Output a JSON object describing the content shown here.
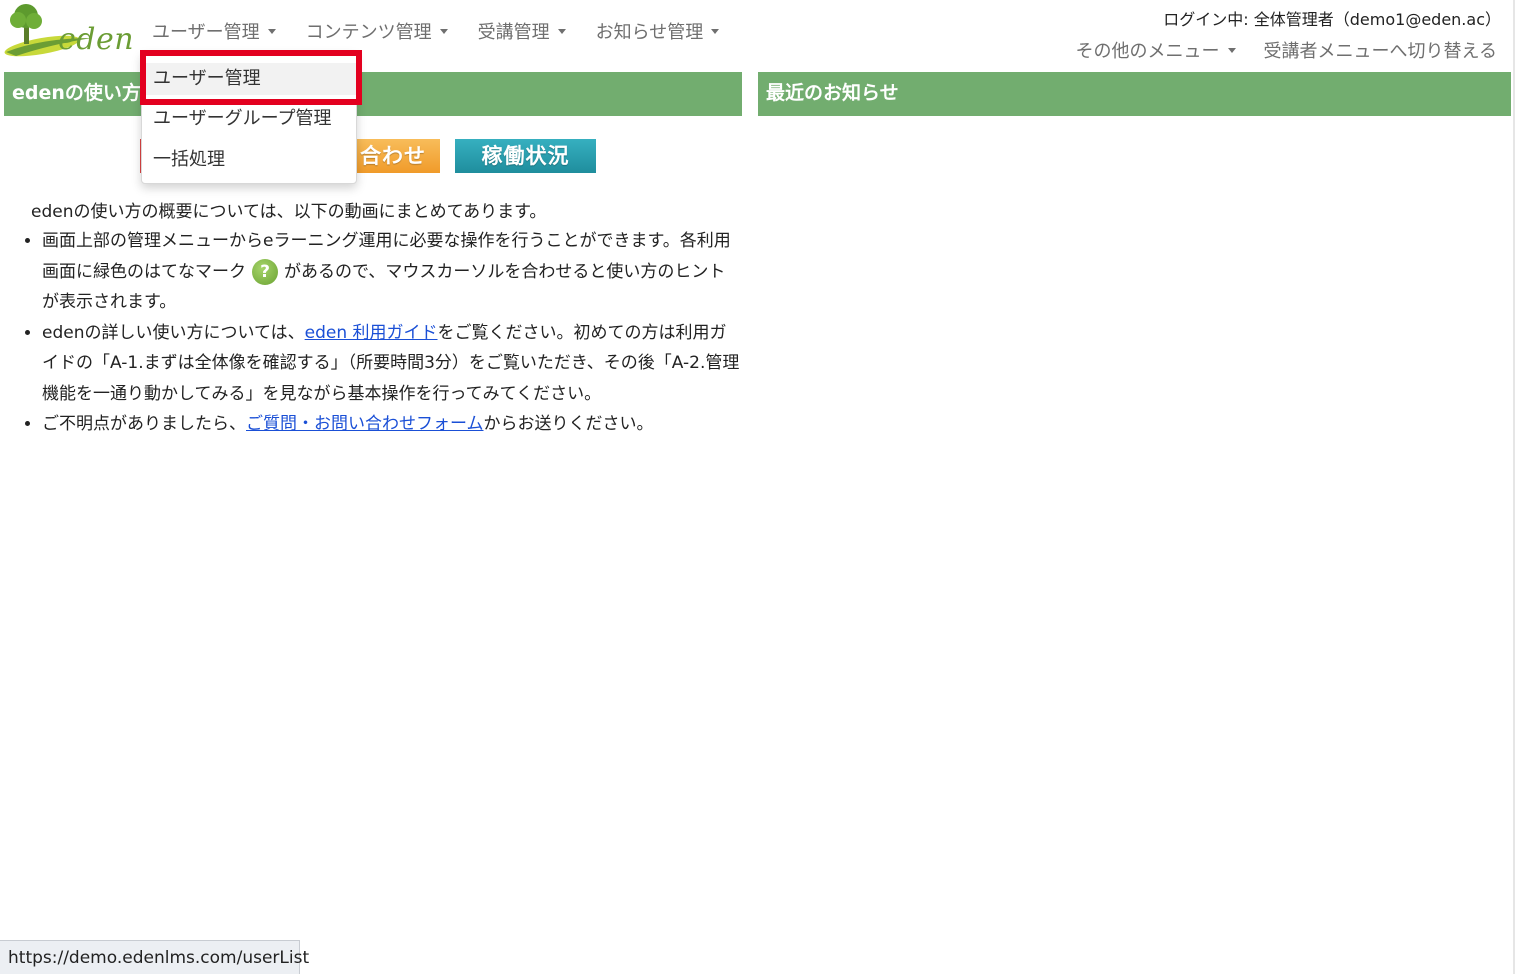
{
  "header": {
    "logo_text": "eden",
    "nav": [
      {
        "label": "ユーザー管理"
      },
      {
        "label": "コンテンツ管理"
      },
      {
        "label": "受講管理"
      },
      {
        "label": "お知らせ管理"
      }
    ],
    "login_info": "ログイン中: 全体管理者（demo1@eden.ac）",
    "other_menu": "その他のメニュー",
    "switch_menu": "受講者メニューへ切り替える"
  },
  "dropdown": {
    "items": [
      {
        "label": "ユーザー管理"
      },
      {
        "label": "ユーザーグループ管理"
      },
      {
        "label": "一括処理"
      }
    ]
  },
  "left_panel": {
    "title": "edenの使い方",
    "buttons": {
      "contact": "合わせ",
      "status": "稼働状況"
    },
    "intro": "edenの使い方の概要については、以下の動画にまとめてあります。",
    "bullet1_a": "画面上部の管理メニューからeラーニング運用に必要な操作を行うことができます。各利用画面に緑色のはてなマーク",
    "bullet1_icon": "?",
    "bullet1_b": "があるので、マウスカーソルを合わせると使い方のヒントが表示されます。",
    "bullet2_a": "edenの詳しい使い方については、",
    "bullet2_link": "eden 利用ガイド",
    "bullet2_b": "をご覧ください。初めての方は利用ガイドの「A-1.まずは全体像を確認する」（所要時間3分）をご覧いただき、その後「A-2.管理機能を一通り動かしてみる」を見ながら基本操作を行ってみてください。",
    "bullet3_a": "ご不明点がありましたら、",
    "bullet3_link": "ご質問・お問い合わせフォーム",
    "bullet3_b": "からお送りください。"
  },
  "right_panel": {
    "title": "最近のお知らせ"
  },
  "status_bar": {
    "url": "https://demo.edenlms.com/userList"
  },
  "colors": {
    "panel_header": "#72ad6f",
    "highlight": "#e3001f",
    "link": "#1a4fd6"
  }
}
